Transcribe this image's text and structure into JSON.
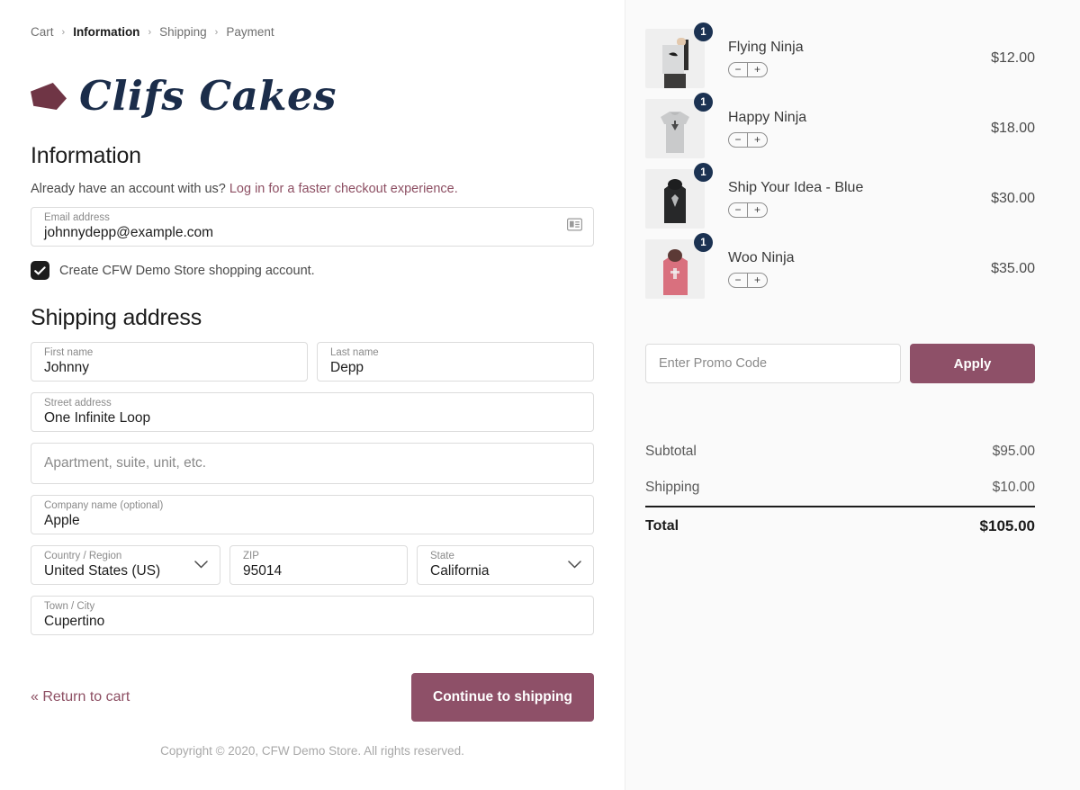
{
  "breadcrumb": {
    "items": [
      {
        "label": "Cart",
        "active": false
      },
      {
        "label": "Information",
        "active": true
      },
      {
        "label": "Shipping",
        "active": false
      },
      {
        "label": "Payment",
        "active": false
      }
    ],
    "separator": "›"
  },
  "brand": {
    "name": "Clifs Cakes",
    "mark_color": "#6f3545",
    "text_color": "#1b2d4a"
  },
  "information": {
    "title": "Information",
    "account_prompt": "Already have an account with us?",
    "login_link": "Log in for a faster checkout experience.",
    "email": {
      "label": "Email address",
      "value": "johnnydepp@example.com",
      "icon": "contact-card-icon"
    },
    "create_account": {
      "label": "Create CFW Demo Store shopping account.",
      "checked": true
    }
  },
  "shipping": {
    "title": "Shipping address",
    "first_name": {
      "label": "First name",
      "value": "Johnny"
    },
    "last_name": {
      "label": "Last name",
      "value": "Depp"
    },
    "street": {
      "label": "Street address",
      "value": "One Infinite Loop"
    },
    "apartment": {
      "label": "",
      "placeholder": "Apartment, suite, unit, etc.",
      "value": ""
    },
    "company": {
      "label": "Company name (optional)",
      "value": "Apple"
    },
    "country": {
      "label": "Country / Region",
      "value": "United States (US)"
    },
    "zip": {
      "label": "ZIP",
      "value": "95014"
    },
    "state": {
      "label": "State",
      "value": "California"
    },
    "city": {
      "label": "Town / City",
      "value": "Cupertino"
    }
  },
  "actions": {
    "return_to_cart": "« Return to cart",
    "continue": "Continue to shipping",
    "cta_color": "#8e5068"
  },
  "footer": {
    "copyright": "Copyright © 2020, CFW Demo Store. All rights reserved."
  },
  "cart": {
    "items": [
      {
        "name": "Flying Ninja",
        "qty": "1",
        "price": "$12.00"
      },
      {
        "name": "Happy Ninja",
        "qty": "1",
        "price": "$18.00"
      },
      {
        "name": "Ship Your Idea - Blue",
        "qty": "1",
        "price": "$30.00"
      },
      {
        "name": "Woo Ninja",
        "qty": "1",
        "price": "$35.00"
      }
    ],
    "stepper": {
      "minus": "−",
      "plus": "+"
    },
    "badge_color": "#1b3252"
  },
  "promo": {
    "placeholder": "Enter Promo Code",
    "value": "",
    "apply_label": "Apply"
  },
  "totals": {
    "subtotal_label": "Subtotal",
    "subtotal_value": "$95.00",
    "shipping_label": "Shipping",
    "shipping_value": "$10.00",
    "total_label": "Total",
    "total_value": "$105.00"
  }
}
